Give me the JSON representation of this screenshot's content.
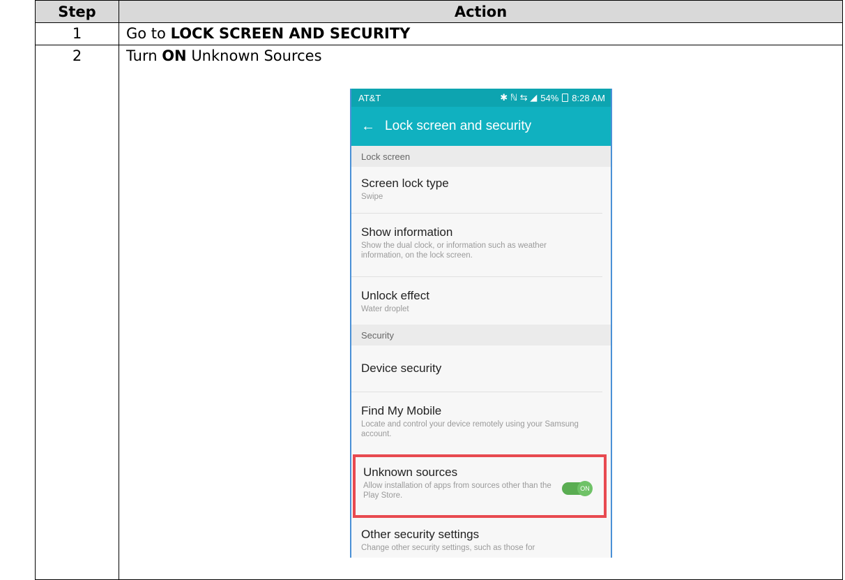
{
  "table": {
    "headers": {
      "step": "Step",
      "action": "Action"
    },
    "rows": [
      {
        "step": "1",
        "action_prefix": "Go to ",
        "action_bold": "LOCK SCREEN AND SECURITY",
        "action_suffix": ""
      },
      {
        "step": "2",
        "action_prefix": "Turn ",
        "action_bold": "ON",
        "action_suffix": " Unknown Sources"
      }
    ]
  },
  "phone": {
    "status": {
      "carrier": "AT&T",
      "icons": "✱ ℕ ⇆ ◢",
      "battery": "54%",
      "time": "8:28 AM"
    },
    "appbar": {
      "back_icon": "←",
      "title": "Lock screen and security"
    },
    "sections": {
      "lock_screen": "Lock screen",
      "security": "Security"
    },
    "items": {
      "screen_lock_type": {
        "title": "Screen lock type",
        "subtitle": "Swipe"
      },
      "show_information": {
        "title": "Show information",
        "subtitle": "Show the dual clock, or information such as weather information, on the lock screen."
      },
      "unlock_effect": {
        "title": "Unlock effect",
        "subtitle": "Water droplet"
      },
      "device_security": {
        "title": "Device security"
      },
      "find_my_mobile": {
        "title": "Find My Mobile",
        "subtitle": "Locate and control your device remotely using your Samsung account."
      },
      "unknown_sources": {
        "title": "Unknown sources",
        "subtitle": "Allow installation of apps from sources other than the Play Store.",
        "toggle_label": "ON"
      },
      "other_security": {
        "title": "Other security settings",
        "subtitle": "Change other security settings, such as those for"
      }
    },
    "colors": {
      "statusbar": "#0da4b0",
      "appbar": "#10b1c0",
      "highlight": "#e84a50",
      "toggle": "#5aad52"
    }
  }
}
